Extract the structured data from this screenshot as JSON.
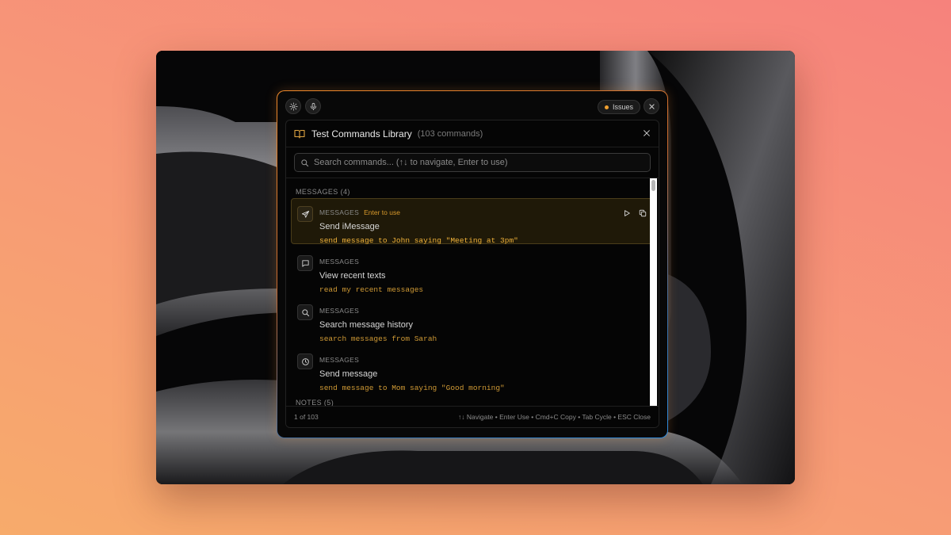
{
  "panel": {
    "issues_label": "Issues"
  },
  "library": {
    "title": "Test Commands Library",
    "count": "(103 commands)"
  },
  "search": {
    "placeholder": "Search commands... (↑↓ to navigate, Enter to use)"
  },
  "sections": [
    {
      "label": "MESSAGES (4)"
    },
    {
      "label": "NOTES (5)"
    }
  ],
  "items": [
    {
      "category": "MESSAGES",
      "hint": "Enter to use",
      "name": "Send iMessage",
      "command": "send message to John saying \"Meeting at 3pm\"",
      "icon": "send-icon"
    },
    {
      "category": "MESSAGES",
      "name": "View recent texts",
      "command": "read my recent messages",
      "icon": "message-bubble-icon"
    },
    {
      "category": "MESSAGES",
      "name": "Search message history",
      "command": "search messages from Sarah",
      "icon": "search-icon"
    },
    {
      "category": "MESSAGES",
      "name": "Send message",
      "command": "send message to Mom saying \"Good morning\"",
      "icon": "clock-icon"
    }
  ],
  "footer": {
    "position": "1 of 103",
    "shortcuts": "↑↓ Navigate • Enter Use • Cmd+C Copy • Tab Cycle • ESC Close"
  },
  "colors": {
    "accent": "#f0a030",
    "background_gradient_start": "#f7ab6b",
    "background_gradient_end": "#f6827c"
  }
}
